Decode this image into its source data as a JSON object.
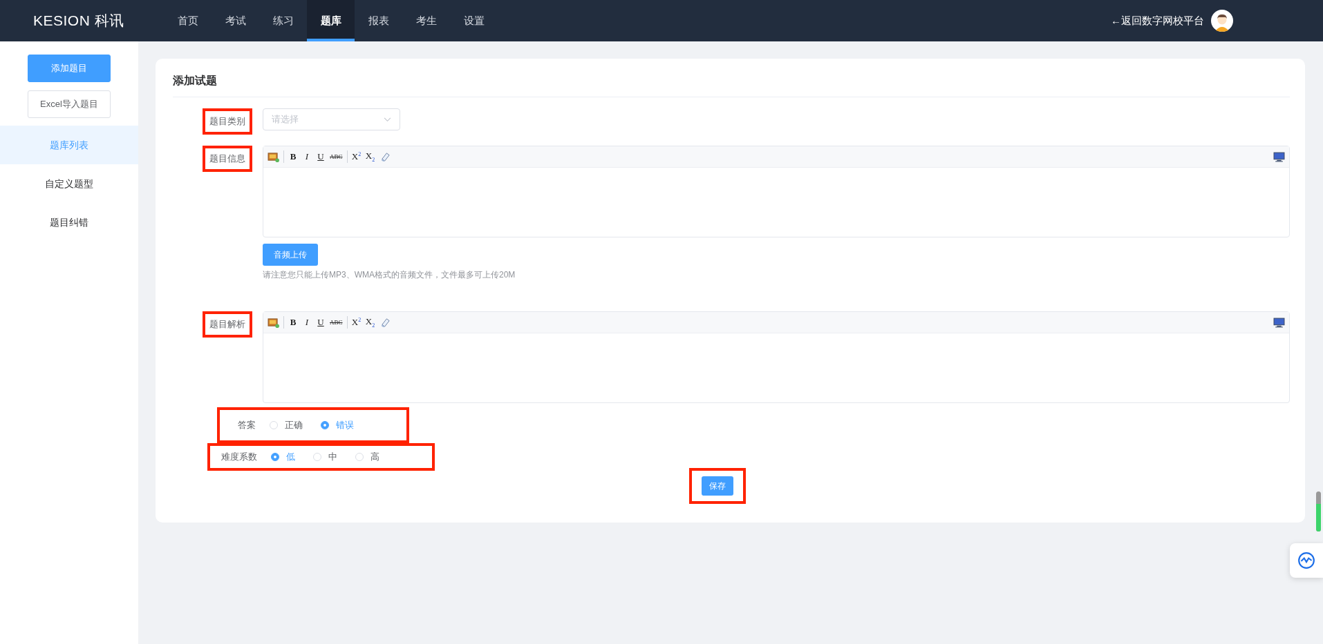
{
  "header": {
    "logo": "KESION 科讯",
    "nav": [
      {
        "label": "首页",
        "selected": false
      },
      {
        "label": "考试",
        "selected": false
      },
      {
        "label": "练习",
        "selected": false
      },
      {
        "label": "题库",
        "selected": true
      },
      {
        "label": "报表",
        "selected": false
      },
      {
        "label": "考生",
        "selected": false
      },
      {
        "label": "设置",
        "selected": false
      }
    ],
    "back_link": "←返回数字网校平台"
  },
  "sidebar": {
    "buttons": [
      {
        "label": "添加题目",
        "kind": "primary"
      },
      {
        "label": "Excel导入题目",
        "kind": "plain"
      }
    ],
    "items": [
      {
        "label": "题库列表",
        "selected": true
      },
      {
        "label": "自定义题型",
        "selected": false
      },
      {
        "label": "题目纠错",
        "selected": false
      }
    ]
  },
  "form": {
    "title": "添加试题",
    "type_field": {
      "label": "题目类别",
      "placeholder": "请选择",
      "highlighted": true
    },
    "question_editor": {
      "label": "题目信息",
      "highlighted": true,
      "tools": [
        {
          "kind": "image"
        },
        {
          "kind": "sep"
        },
        {
          "kind": "bold",
          "label": "B"
        },
        {
          "kind": "italic",
          "label": "I"
        },
        {
          "kind": "underline",
          "label": "U"
        },
        {
          "kind": "strike",
          "label": "ABC"
        },
        {
          "kind": "sep"
        },
        {
          "kind": "superscript",
          "label": "X$^{2}$"
        },
        {
          "kind": "subscript",
          "label": "X$_{2}$"
        },
        {
          "kind": "eraser"
        }
      ]
    },
    "audio_button": "音频上传",
    "audio_hint": "请注意您只能上传MP3、WMA格式的音频文件，文件最多可上传20M",
    "analysis_editor": {
      "label": "题目解析",
      "highlighted": true,
      "tools": [
        {
          "kind": "image"
        },
        {
          "kind": "sep"
        },
        {
          "kind": "bold",
          "label": "B"
        },
        {
          "kind": "italic",
          "label": "I"
        },
        {
          "kind": "underline",
          "label": "U"
        },
        {
          "kind": "strike",
          "label": "ABC"
        },
        {
          "kind": "sep"
        },
        {
          "kind": "superscript",
          "label": "X$^{2}$"
        },
        {
          "kind": "subscript",
          "label": "X$_{2}$"
        },
        {
          "kind": "eraser"
        }
      ]
    },
    "radio_groups": [
      {
        "label": "答案",
        "highlighted": true,
        "options": [
          {
            "label": "正确",
            "selected": false
          },
          {
            "label": "错误",
            "selected": true
          }
        ]
      },
      {
        "label": "难度系数",
        "highlighted": true,
        "options": [
          {
            "label": "低",
            "selected": true
          },
          {
            "label": "中",
            "selected": false
          },
          {
            "label": "高",
            "selected": false
          }
        ]
      }
    ],
    "save_button": {
      "label": "保存",
      "highlighted": true
    }
  }
}
